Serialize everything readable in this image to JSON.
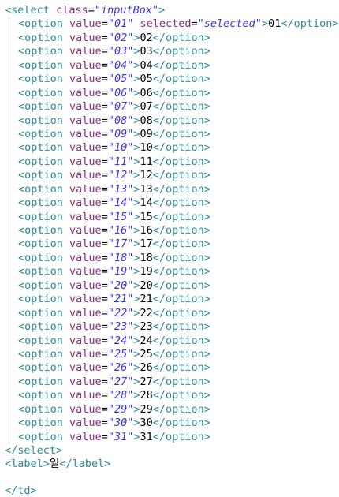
{
  "select": {
    "tag": "select",
    "class_attr": "class",
    "class_value": "inputBox"
  },
  "option_tag": "option",
  "value_attr": "value",
  "selected_attr": "selected",
  "selected_value": "selected",
  "options": [
    "01",
    "02",
    "03",
    "04",
    "05",
    "06",
    "07",
    "08",
    "09",
    "10",
    "11",
    "12",
    "13",
    "14",
    "15",
    "16",
    "17",
    "18",
    "19",
    "20",
    "21",
    "22",
    "23",
    "24",
    "25",
    "26",
    "27",
    "28",
    "29",
    "30",
    "31"
  ],
  "label": {
    "tag": "label",
    "text": "일"
  },
  "next_line_partial": "</td>"
}
